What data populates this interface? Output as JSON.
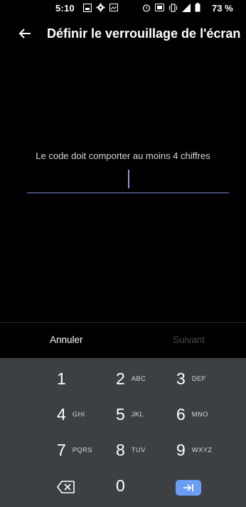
{
  "status_bar": {
    "time": "5:10",
    "battery": "73 %"
  },
  "header": {
    "title": "Définir le verrouillage de l'écran"
  },
  "pin": {
    "hint": "Le code doit comporter au moins 4 chiffres",
    "value": ""
  },
  "actions": {
    "cancel_label": "Annuler",
    "next_label": "Suivant"
  },
  "keypad": {
    "keys": [
      {
        "num": "1",
        "letters": ""
      },
      {
        "num": "2",
        "letters": "ABC"
      },
      {
        "num": "3",
        "letters": "DEF"
      },
      {
        "num": "4",
        "letters": "GHI"
      },
      {
        "num": "5",
        "letters": "JKL"
      },
      {
        "num": "6",
        "letters": "MNO"
      },
      {
        "num": "7",
        "letters": "PQRS"
      },
      {
        "num": "8",
        "letters": "TUV"
      },
      {
        "num": "9",
        "letters": "WXYZ"
      },
      {
        "num": "0",
        "letters": ""
      }
    ]
  },
  "colors": {
    "background": "#000000",
    "keypad_background": "#3c4043",
    "accent": "#6c9df5",
    "underline": "#7b86c9",
    "disabled_text": "#4a4a4a"
  }
}
